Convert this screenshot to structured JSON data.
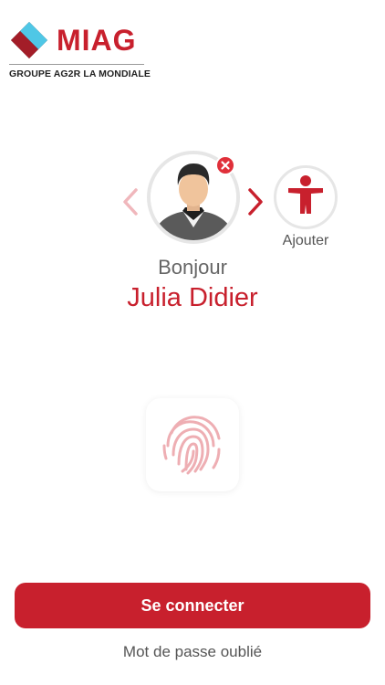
{
  "brand": {
    "name": "MIAG",
    "subtitle": "GROUPE AG2R LA MONDIALE",
    "colors": {
      "red": "#c8202d",
      "cyan": "#4fc7e6",
      "dark": "#2b2b2b"
    }
  },
  "profile": {
    "greeting": "Bonjour",
    "name": "Julia Didier",
    "avatar_icon": "person-avatar-icon",
    "remove_icon": "close-icon"
  },
  "nav": {
    "previous_icon": "chevron-left-icon",
    "next_icon": "chevron-right-icon"
  },
  "add_account": {
    "label": "Ajouter",
    "icon": "accessibility-person-icon"
  },
  "biometric": {
    "icon": "fingerprint-icon"
  },
  "actions": {
    "connect_label": "Se connecter",
    "forgot_label": "Mot de passe oublié"
  },
  "colors": {
    "accent": "#c8202d",
    "remove": "#e0303a",
    "chevron_disabled": "#f0b7bc",
    "fingerprint": "#eeaeb3"
  }
}
